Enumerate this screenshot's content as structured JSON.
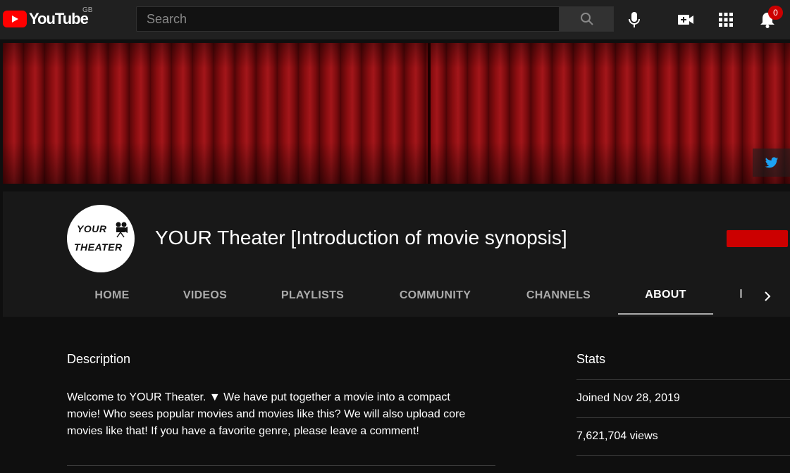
{
  "topbar": {
    "logo_text": "YouTube",
    "region": "GB",
    "search_placeholder": "Search",
    "notification_count": "0",
    "icons": [
      "search-icon",
      "microphone-icon",
      "create-video-icon",
      "apps-grid-icon",
      "bell-icon"
    ]
  },
  "banner": {
    "link_icon": "twitter-icon"
  },
  "channel": {
    "avatar_line1": "YOUR",
    "avatar_line2": "THEATER",
    "title": "YOUR Theater [Introduction of movie synopsis]"
  },
  "tabs": [
    {
      "label": "HOME",
      "active": false
    },
    {
      "label": "VIDEOS",
      "active": false
    },
    {
      "label": "PLAYLISTS",
      "active": false
    },
    {
      "label": "COMMUNITY",
      "active": false
    },
    {
      "label": "CHANNELS",
      "active": false
    },
    {
      "label": "ABOUT",
      "active": true
    }
  ],
  "about": {
    "description_heading": "Description",
    "description_text": "Welcome to YOUR Theater. ▼ We have put together a movie into a compact\nmovie! Who sees popular movies and movies like this? We will also upload core\nmovies like that! If you have a favorite genre, please leave a comment!",
    "stats_heading": "Stats",
    "joined": "Joined Nov 28, 2019",
    "views": "7,621,704 views"
  },
  "colors": {
    "brand_red": "#ff0000",
    "subscribe_red": "#cc0000",
    "twitter_blue": "#1da1f2",
    "background": "#0f0f0f"
  }
}
